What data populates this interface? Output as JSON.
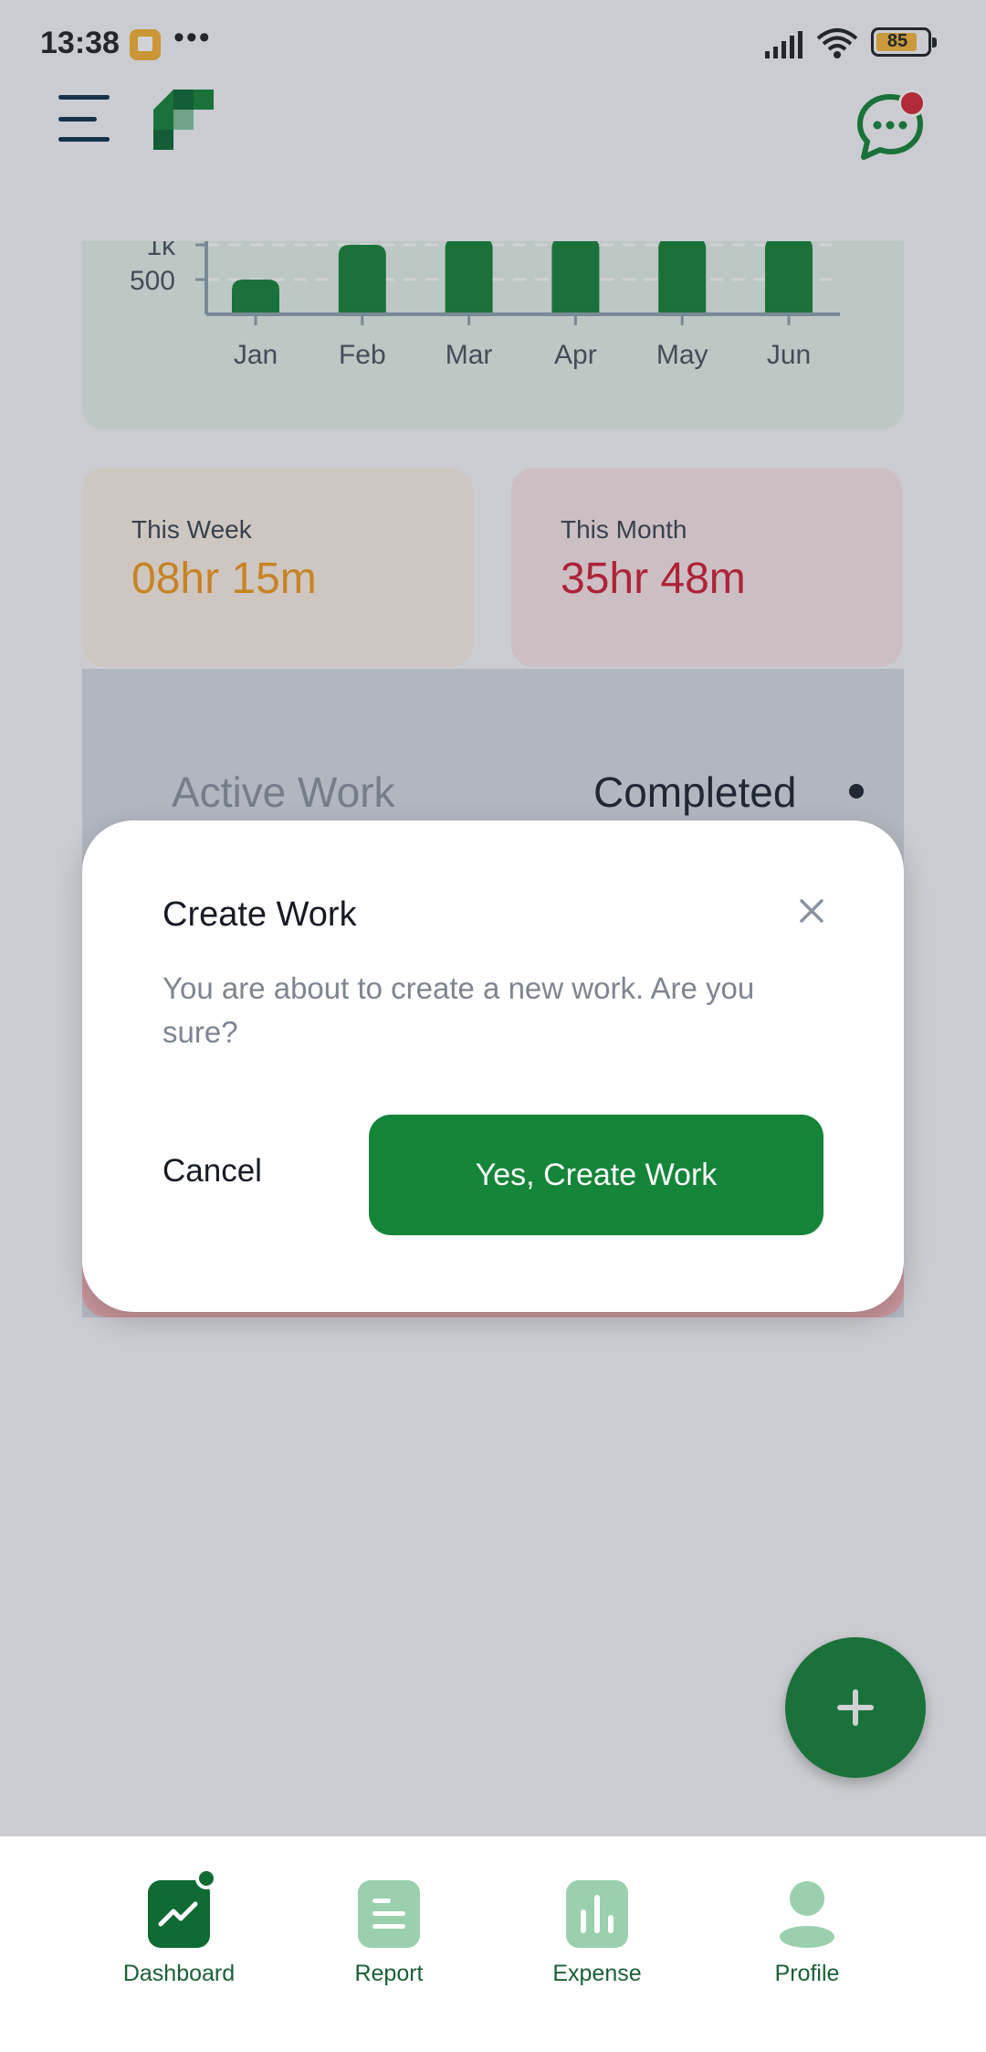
{
  "status_bar": {
    "time": "13:38",
    "battery": "85",
    "more_dots": "•••"
  },
  "header": {
    "menu_icon": "hamburger-menu-icon",
    "logo_icon": "app-logo",
    "chat_icon": "chat-bubble-icon",
    "chat_has_notification": true
  },
  "chart_data": {
    "type": "bar",
    "categories": [
      "Jan",
      "Feb",
      "Mar",
      "Apr",
      "May",
      "Jun"
    ],
    "values": [
      500,
      1000,
      1100,
      1100,
      1100,
      1100
    ],
    "yticks": [
      {
        "label": "500",
        "value": 500
      },
      {
        "label": "1k",
        "value": 1000
      }
    ],
    "ylim": [
      0,
      1000
    ],
    "bar_color": "#158539",
    "grid": true
  },
  "stats": {
    "week": {
      "label": "This Week",
      "value": "08hr 15m"
    },
    "month": {
      "label": "This Month",
      "value": "35hr 48m"
    }
  },
  "tabs": {
    "active": "Active Work",
    "completed": "Completed"
  },
  "dialog": {
    "title": "Create Work",
    "message": "You are about to create a new work. Are you sure?",
    "cancel": "Cancel",
    "confirm": "Yes, Create Work",
    "close_icon": "close-icon"
  },
  "fab": {
    "icon": "plus-icon"
  },
  "bottom_nav": {
    "items": [
      {
        "label": "Dashboard",
        "icon": "dashboard-chart-icon",
        "active": true
      },
      {
        "label": "Report",
        "icon": "report-document-icon",
        "active": false
      },
      {
        "label": "Expense",
        "icon": "expense-bars-icon",
        "active": false
      },
      {
        "label": "Profile",
        "icon": "profile-person-icon",
        "active": false
      }
    ]
  },
  "colors": {
    "brand_green": "#158539",
    "week_orange": "#f39a1d",
    "month_red": "#d31f37"
  }
}
